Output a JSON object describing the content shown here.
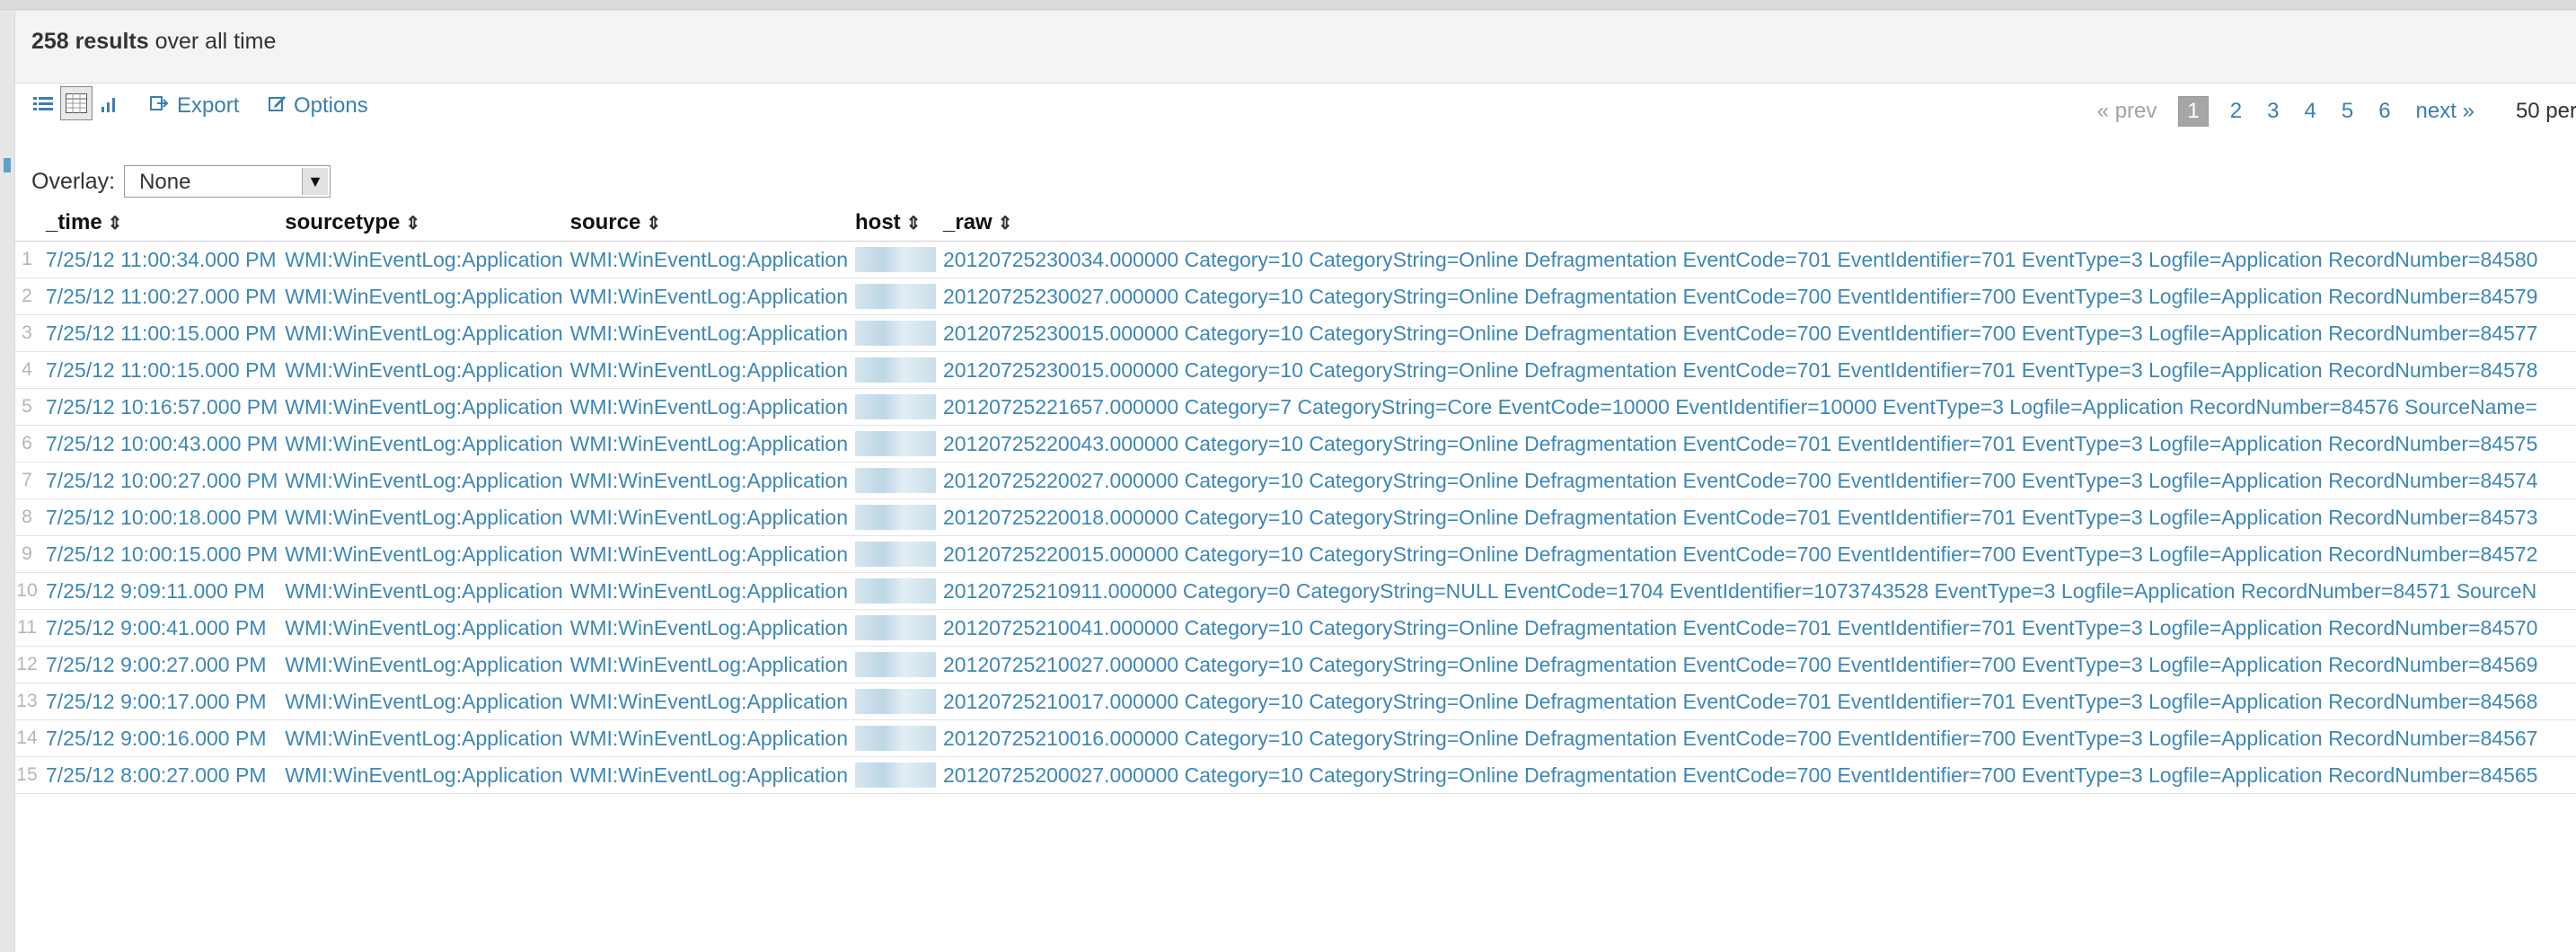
{
  "results": {
    "count": "258 results",
    "suffix": "over all time"
  },
  "toolbar": {
    "export_label": "Export",
    "options_label": "Options"
  },
  "pagination": {
    "prev": "« prev",
    "pages": [
      "1",
      "2",
      "3",
      "4",
      "5",
      "6"
    ],
    "current": "1",
    "next": "next »",
    "per_page": "50 per"
  },
  "overlay": {
    "label": "Overlay:",
    "value": "None"
  },
  "table": {
    "columns": [
      "_time",
      "sourcetype",
      "source",
      "host",
      "_raw"
    ],
    "sort_glyph": "⇕",
    "rows": [
      {
        "n": "1",
        "time": "7/25/12 11:00:34.000 PM",
        "sourcetype": "WMI:WinEventLog:Application",
        "source": "WMI:WinEventLog:Application",
        "raw": "20120725230034.000000 Category=10 CategoryString=Online Defragmentation EventCode=701 EventIdentifier=701 EventType=3 Logfile=Application RecordNumber=84580"
      },
      {
        "n": "2",
        "time": "7/25/12 11:00:27.000 PM",
        "sourcetype": "WMI:WinEventLog:Application",
        "source": "WMI:WinEventLog:Application",
        "raw": "20120725230027.000000 Category=10 CategoryString=Online Defragmentation EventCode=700 EventIdentifier=700 EventType=3 Logfile=Application RecordNumber=84579"
      },
      {
        "n": "3",
        "time": "7/25/12 11:00:15.000 PM",
        "sourcetype": "WMI:WinEventLog:Application",
        "source": "WMI:WinEventLog:Application",
        "raw": "20120725230015.000000 Category=10 CategoryString=Online Defragmentation EventCode=700 EventIdentifier=700 EventType=3 Logfile=Application RecordNumber=84577"
      },
      {
        "n": "4",
        "time": "7/25/12 11:00:15.000 PM",
        "sourcetype": "WMI:WinEventLog:Application",
        "source": "WMI:WinEventLog:Application",
        "raw": "20120725230015.000000 Category=10 CategoryString=Online Defragmentation EventCode=701 EventIdentifier=701 EventType=3 Logfile=Application RecordNumber=84578"
      },
      {
        "n": "5",
        "time": "7/25/12 10:16:57.000 PM",
        "sourcetype": "WMI:WinEventLog:Application",
        "source": "WMI:WinEventLog:Application",
        "raw": "20120725221657.000000 Category=7 CategoryString=Core EventCode=10000 EventIdentifier=10000 EventType=3 Logfile=Application RecordNumber=84576 SourceName="
      },
      {
        "n": "6",
        "time": "7/25/12 10:00:43.000 PM",
        "sourcetype": "WMI:WinEventLog:Application",
        "source": "WMI:WinEventLog:Application",
        "raw": "20120725220043.000000 Category=10 CategoryString=Online Defragmentation EventCode=701 EventIdentifier=701 EventType=3 Logfile=Application RecordNumber=84575"
      },
      {
        "n": "7",
        "time": "7/25/12 10:00:27.000 PM",
        "sourcetype": "WMI:WinEventLog:Application",
        "source": "WMI:WinEventLog:Application",
        "raw": "20120725220027.000000 Category=10 CategoryString=Online Defragmentation EventCode=700 EventIdentifier=700 EventType=3 Logfile=Application RecordNumber=84574"
      },
      {
        "n": "8",
        "time": "7/25/12 10:00:18.000 PM",
        "sourcetype": "WMI:WinEventLog:Application",
        "source": "WMI:WinEventLog:Application",
        "raw": "20120725220018.000000 Category=10 CategoryString=Online Defragmentation EventCode=701 EventIdentifier=701 EventType=3 Logfile=Application RecordNumber=84573"
      },
      {
        "n": "9",
        "time": "7/25/12 10:00:15.000 PM",
        "sourcetype": "WMI:WinEventLog:Application",
        "source": "WMI:WinEventLog:Application",
        "raw": "20120725220015.000000 Category=10 CategoryString=Online Defragmentation EventCode=700 EventIdentifier=700 EventType=3 Logfile=Application RecordNumber=84572"
      },
      {
        "n": "10",
        "time": "7/25/12 9:09:11.000 PM",
        "sourcetype": "WMI:WinEventLog:Application",
        "source": "WMI:WinEventLog:Application",
        "raw": "20120725210911.000000 Category=0 CategoryString=NULL EventCode=1704 EventIdentifier=1073743528 EventType=3 Logfile=Application RecordNumber=84571 SourceN"
      },
      {
        "n": "11",
        "time": "7/25/12 9:00:41.000 PM",
        "sourcetype": "WMI:WinEventLog:Application",
        "source": "WMI:WinEventLog:Application",
        "raw": "20120725210041.000000 Category=10 CategoryString=Online Defragmentation EventCode=701 EventIdentifier=701 EventType=3 Logfile=Application RecordNumber=84570"
      },
      {
        "n": "12",
        "time": "7/25/12 9:00:27.000 PM",
        "sourcetype": "WMI:WinEventLog:Application",
        "source": "WMI:WinEventLog:Application",
        "raw": "20120725210027.000000 Category=10 CategoryString=Online Defragmentation EventCode=700 EventIdentifier=700 EventType=3 Logfile=Application RecordNumber=84569"
      },
      {
        "n": "13",
        "time": "7/25/12 9:00:17.000 PM",
        "sourcetype": "WMI:WinEventLog:Application",
        "source": "WMI:WinEventLog:Application",
        "raw": "20120725210017.000000 Category=10 CategoryString=Online Defragmentation EventCode=701 EventIdentifier=701 EventType=3 Logfile=Application RecordNumber=84568"
      },
      {
        "n": "14",
        "time": "7/25/12 9:00:16.000 PM",
        "sourcetype": "WMI:WinEventLog:Application",
        "source": "WMI:WinEventLog:Application",
        "raw": "20120725210016.000000 Category=10 CategoryString=Online Defragmentation EventCode=700 EventIdentifier=700 EventType=3 Logfile=Application RecordNumber=84567"
      },
      {
        "n": "15",
        "time": "7/25/12 8:00:27.000 PM",
        "sourcetype": "WMI:WinEventLog:Application",
        "source": "WMI:WinEventLog:Application",
        "raw": "20120725200027.000000 Category=10 CategoryString=Online Defragmentation EventCode=700 EventIdentifier=700 EventType=3 Logfile=Application RecordNumber=84565"
      }
    ]
  },
  "colors": {
    "link": "#3d87b5",
    "row_number": "#b5b5b5",
    "header_bg": "#f4f4f4"
  }
}
